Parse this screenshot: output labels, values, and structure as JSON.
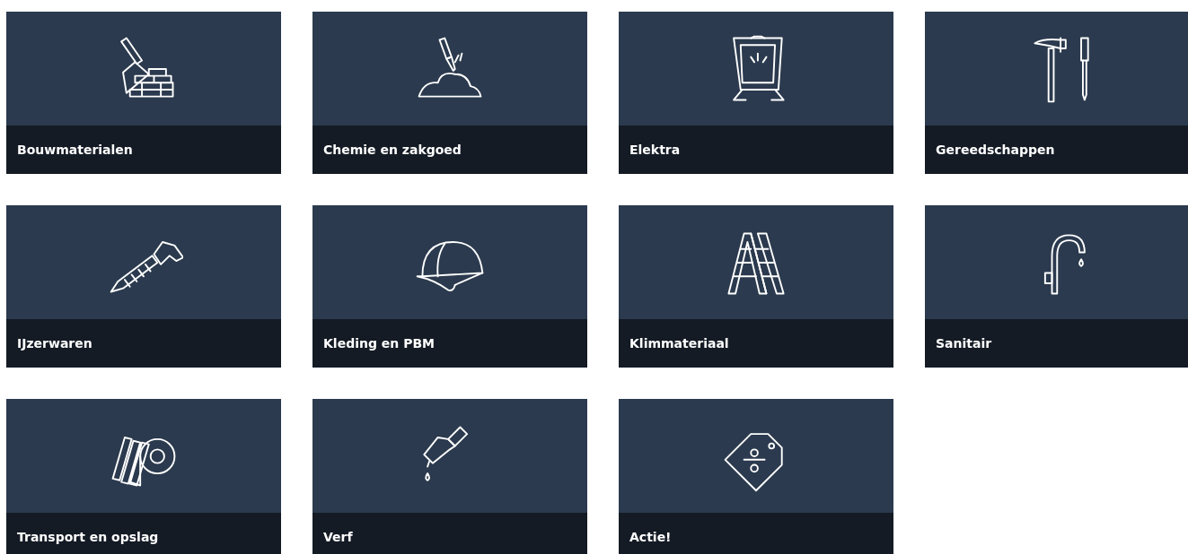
{
  "categories": [
    {
      "label": "Bouwmaterialen"
    },
    {
      "label": "Chemie en zakgoed"
    },
    {
      "label": "Elektra"
    },
    {
      "label": "Gereedschappen"
    },
    {
      "label": "IJzerwaren"
    },
    {
      "label": "Kleding en PBM"
    },
    {
      "label": "Klimmateriaal"
    },
    {
      "label": "Sanitair"
    },
    {
      "label": "Transport en opslag"
    },
    {
      "label": "Verf"
    },
    {
      "label": "Actie!"
    }
  ]
}
